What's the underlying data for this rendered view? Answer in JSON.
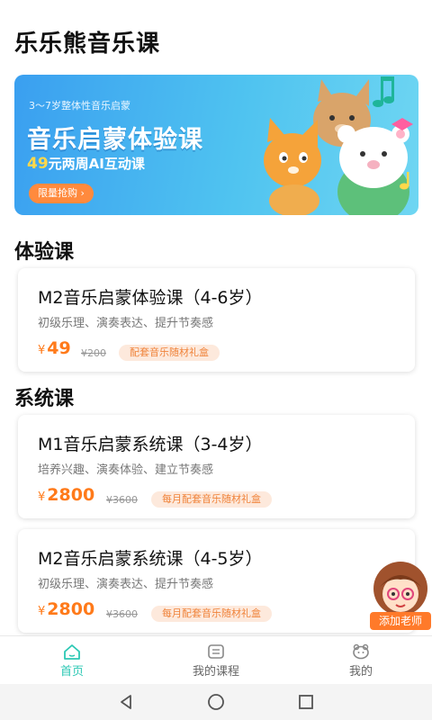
{
  "header": {
    "title": "乐乐熊音乐课"
  },
  "banner": {
    "subtitle": "3～7岁整体性音乐启蒙",
    "title": "音乐启蒙体验课",
    "price_number": "49",
    "price_suffix": "元两周AI互动课",
    "button_label": "限量抢购 ›"
  },
  "sections": {
    "trial_title": "体验课",
    "system_title": "系统课"
  },
  "trial_course": {
    "title": "M2音乐启蒙体验课（4-6岁）",
    "description": "初级乐理、演奏表达、提升节奏感",
    "currency": "¥",
    "price": "49",
    "original_price": "¥200",
    "badge": "配套音乐随材礼盒"
  },
  "system_courses": [
    {
      "title": "M1音乐启蒙系统课（3-4岁）",
      "description": "培养兴趣、演奏体验、建立节奏感",
      "currency": "¥",
      "price": "2800",
      "original_price": "¥3600",
      "badge": "每月配套音乐随材礼盒"
    },
    {
      "title": "M2音乐启蒙系统课（4-5岁）",
      "description": "初级乐理、演奏表达、提升节奏感",
      "currency": "¥",
      "price": "2800",
      "original_price": "¥3600",
      "badge": "每月配套音乐随材礼盒"
    }
  ],
  "floating": {
    "add_teacher_label": "添加老师"
  },
  "tabbar": {
    "items": [
      {
        "label": "首页",
        "icon": "home-icon",
        "active": true
      },
      {
        "label": "我的课程",
        "icon": "course-icon",
        "active": false
      },
      {
        "label": "我的",
        "icon": "profile-icon",
        "active": false
      }
    ]
  },
  "colors": {
    "accent": "#2cc8b4",
    "price": "#ff7a1a",
    "banner": "#3a9ff0"
  }
}
